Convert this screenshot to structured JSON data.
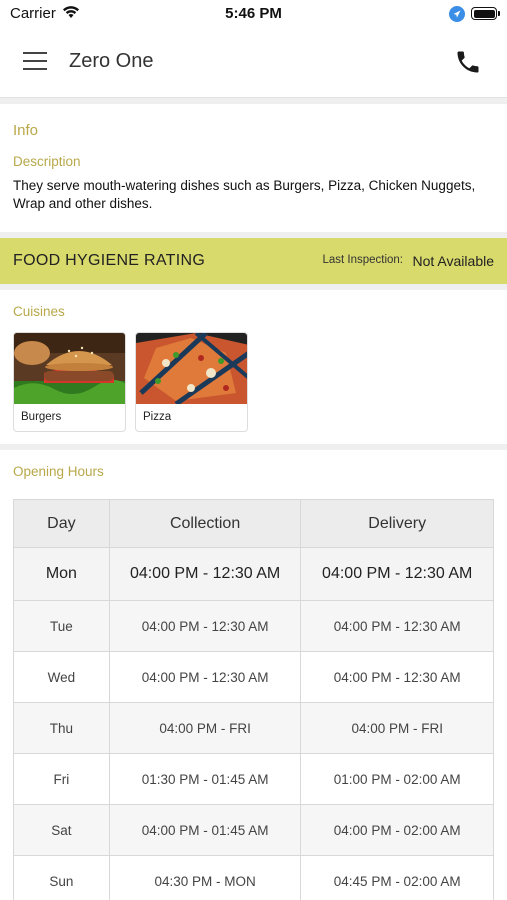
{
  "status_bar": {
    "carrier": "Carrier",
    "time": "5:46 PM"
  },
  "navbar": {
    "title": "Zero One"
  },
  "info": {
    "heading": "Info",
    "description_label": "Description",
    "description": "They serve mouth-watering dishes such as Burgers, Pizza, Chicken Nuggets, Wrap and other dishes."
  },
  "hygiene": {
    "title": "FOOD HYGIENE RATING",
    "last_inspection_label": "Last Inspection:",
    "last_inspection_value": "Not Available",
    "background_color": "#d8da6c"
  },
  "cuisines": {
    "heading": "Cuisines",
    "items": [
      {
        "name": "Burgers",
        "image": "burger-photo"
      },
      {
        "name": "Pizza",
        "image": "pizza-photo"
      }
    ]
  },
  "opening_hours": {
    "heading": "Opening Hours",
    "columns": [
      "Day",
      "Collection",
      "Delivery"
    ],
    "rows": [
      {
        "day": "Mon",
        "collection": "04:00 PM - 12:30 AM",
        "delivery": "04:00 PM - 12:30 AM"
      },
      {
        "day": "Tue",
        "collection": "04:00 PM - 12:30 AM",
        "delivery": "04:00 PM - 12:30 AM"
      },
      {
        "day": "Wed",
        "collection": "04:00 PM - 12:30 AM",
        "delivery": "04:00 PM - 12:30 AM"
      },
      {
        "day": "Thu",
        "collection": "04:00 PM - FRI",
        "delivery": "04:00 PM - FRI"
      },
      {
        "day": "Fri",
        "collection": "01:30 PM - 01:45 AM",
        "delivery": "01:00 PM - 02:00 AM"
      },
      {
        "day": "Sat",
        "collection": "04:00 PM - 01:45 AM",
        "delivery": "04:00 PM - 02:00 AM"
      },
      {
        "day": "Sun",
        "collection": "04:30 PM - MON",
        "delivery": "04:45 PM - 02:00 AM"
      }
    ]
  },
  "colors": {
    "accent_label": "#b8a84a",
    "location_icon": "#3a8ee6"
  }
}
